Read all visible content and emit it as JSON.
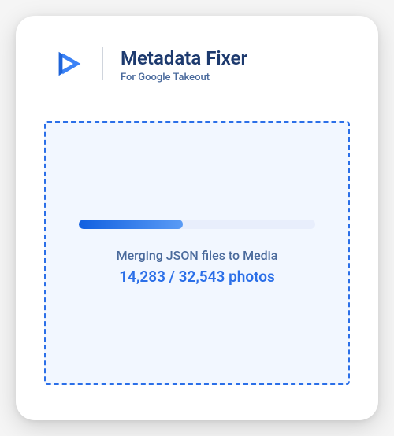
{
  "header": {
    "title": "Metadata Fixer",
    "subtitle": "For Google Takeout"
  },
  "progress": {
    "status_text": "Merging JSON files to Media",
    "count_text": "14,283 / 32,543 photos",
    "percent": 44
  }
}
